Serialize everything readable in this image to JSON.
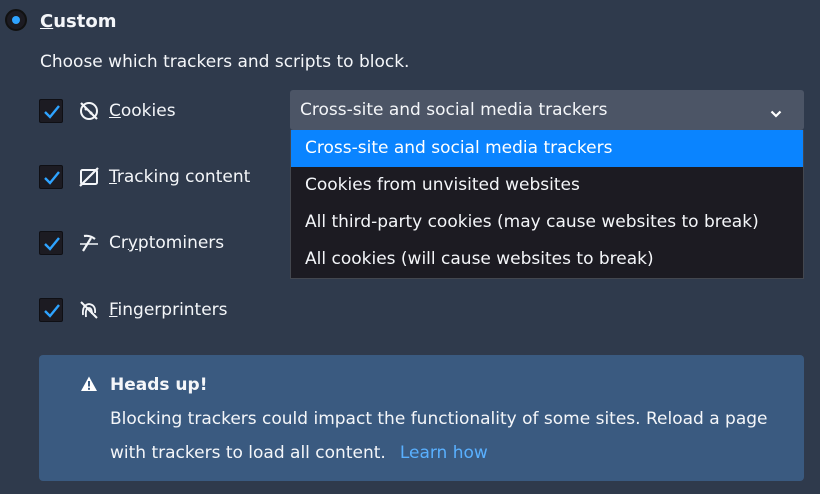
{
  "custom": {
    "heading_accel": "C",
    "heading_rest": "ustom",
    "description": "Choose which trackers and scripts to block."
  },
  "trackers": [
    {
      "icon": "cookies-icon",
      "accel": "C",
      "rest": "ookies",
      "checked": true
    },
    {
      "icon": "tracking-content-icon",
      "accel": "T",
      "rest": "racking content",
      "checked": true
    },
    {
      "icon": "cryptominers-icon",
      "accel": "",
      "rest": "Cryptominers",
      "accel_after": "y",
      "checked": true
    },
    {
      "icon": "fingerprinters-icon",
      "accel": "F",
      "rest": "ingerprinters",
      "checked": true
    }
  ],
  "cookie_select": {
    "selected": "Cross-site and social media trackers",
    "options": [
      "Cross-site and social media trackers",
      "Cookies from unvisited websites",
      "All third-party cookies (may cause websites to break)",
      "All cookies (will cause websites to break)"
    ]
  },
  "notice": {
    "title": "Heads up!",
    "body": "Blocking trackers could impact the functionality of some sites. Reload a page with trackers to load all content.",
    "link": "Learn how"
  },
  "colors": {
    "background": "#2f3a4c",
    "accent": "#0a84ff",
    "checkmark": "#2ea3ff",
    "notice_bg": "#3a5a80",
    "link": "#59b0ff"
  }
}
